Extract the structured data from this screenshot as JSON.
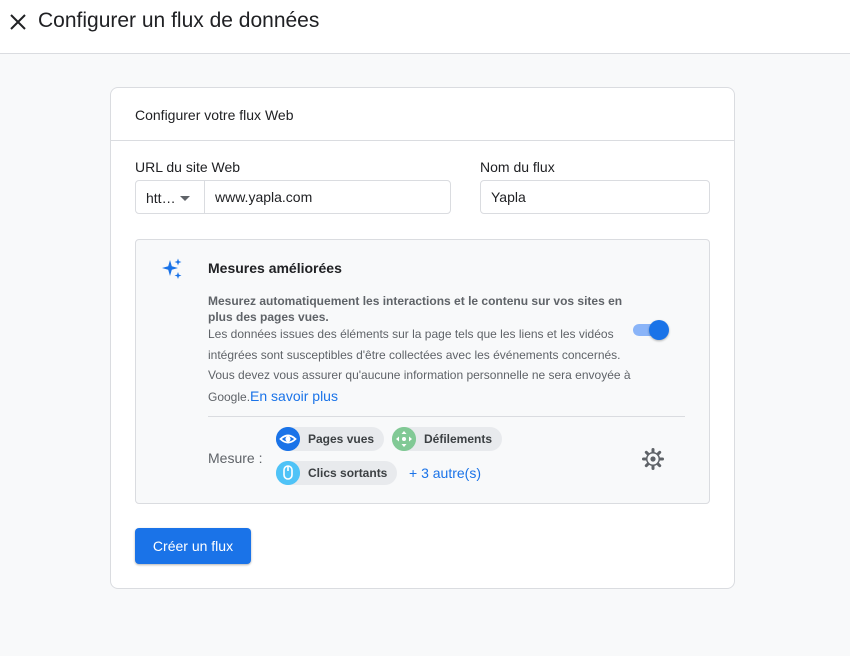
{
  "header": {
    "title": "Configurer un flux de données",
    "close_icon": "close-icon"
  },
  "card": {
    "title": "Configurer votre flux Web",
    "url_label": "URL du site Web",
    "protocol_value": "htt…",
    "url_value": "www.yapla.com",
    "name_label": "Nom du flux",
    "name_value": "Yapla"
  },
  "enhanced": {
    "icon": "sparkle-icon",
    "title": "Mesures améliorées",
    "bold_text": "Mesurez automatiquement les interactions et le contenu sur vos sites en plus des pages vues.",
    "description": "Les données issues des éléments sur la page tels que les liens et les vidéos intégrées sont susceptibles d'être collectées avec les événements concernés. Vous devez vous assurer qu'aucune information personnelle ne sera envoyée à Google.",
    "learn_more": "En savoir plus",
    "toggle_on": true,
    "measure_label": "Mesure :",
    "chips": [
      {
        "label": "Pages vues",
        "icon": "eye-icon",
        "color": "#1a73e8"
      },
      {
        "label": "Défilements",
        "icon": "scroll-arrows-icon",
        "color": "#81c995"
      },
      {
        "label": "Clics sortants",
        "icon": "mouse-icon",
        "color": "#4fc3f7"
      }
    ],
    "others_link": "+ 3 autre(s)",
    "settings_icon": "gear-icon"
  },
  "actions": {
    "create_label": "Créer un flux"
  },
  "colors": {
    "accent": "#1a73e8",
    "border": "#dadce0",
    "background": "#f8f9fa"
  }
}
